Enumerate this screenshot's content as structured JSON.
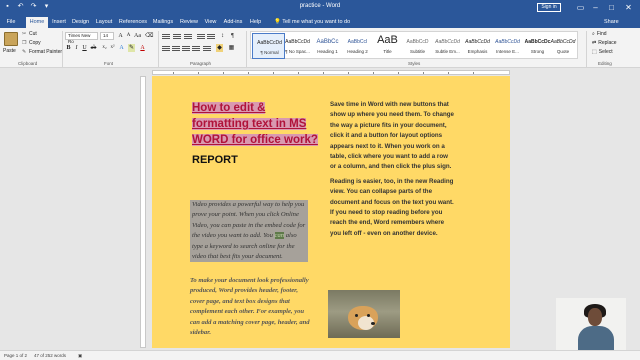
{
  "window": {
    "title": "practice - Word",
    "signin_label": "Sign in",
    "controls": [
      "–",
      "□",
      "✕"
    ]
  },
  "tabs": [
    "File",
    "Home",
    "Insert",
    "Design",
    "Layout",
    "References",
    "Mailings",
    "Review",
    "View",
    "Add-ins",
    "Help"
  ],
  "active_tab": "Home",
  "tell_me": "Tell me what you want to do",
  "share_label": "Share",
  "clipboard": {
    "paste_label": "Paste",
    "cut_label": "Cut",
    "copy_label": "Copy",
    "format_painter_label": "Format Painter",
    "group_label": "Clipboard"
  },
  "font": {
    "name": "Times New Ro",
    "size": "14",
    "group_label": "Font"
  },
  "paragraph": {
    "group_label": "Paragraph"
  },
  "styles": {
    "group_label": "Styles",
    "items": [
      {
        "sample": "AaBbCcDd",
        "name": "¶ Normal",
        "selected": true
      },
      {
        "sample": "AaBbCcDd",
        "name": "¶ No Spac...",
        "selected": false
      },
      {
        "sample": "AaBbCc",
        "name": "Heading 1",
        "selected": false
      },
      {
        "sample": "AaBbCcI",
        "name": "Heading 2",
        "selected": false
      },
      {
        "sample": "AaB",
        "name": "Title",
        "selected": false
      },
      {
        "sample": "AaBbCcD",
        "name": "Subtitle",
        "selected": false
      },
      {
        "sample": "AaBbCcDd",
        "name": "Subtle Em...",
        "selected": false
      },
      {
        "sample": "AaBbCcDd",
        "name": "Emphasis",
        "selected": false
      },
      {
        "sample": "AaBbCcDd",
        "name": "Intense E...",
        "selected": false
      },
      {
        "sample": "AaBbCcDc",
        "name": "Strong",
        "selected": false
      },
      {
        "sample": "AaBbCcDd",
        "name": "Quote",
        "selected": false
      }
    ]
  },
  "editing": {
    "find_label": "Find",
    "replace_label": "Replace",
    "select_label": "Select",
    "group_label": "Editing"
  },
  "document": {
    "heading": "How to edit & formatting text in MS WORD for office work?",
    "subheading": "REPORT",
    "para1_before": "Video provides a powerful way to help you prove your point. When you click Online Video, you can paste in the embed code for the video you want to add. You ",
    "para1_highlight": "can",
    "para1_after": " also type a keyword to search online for the video that best fits your document.",
    "para2": "To make your document look professionally produced, Word provides header, footer, cover page, and text box designs that complement each other. For example, you can add a matching cover page, header, and sidebar.",
    "right_para1": "Save time in Word with new buttons that show up where you need them. To change the way a picture fits in your document, click it and a button for layout options appears next to it. When you work on a table, click where you want to add a row or a column, and then click the plus sign.",
    "right_para2": "Reading is easier, too, in the new Reading view. You can collapse parts of the document and focus on the text you want. If you need to stop reading before you reach the end, Word remembers where you left off - even on another device."
  },
  "colors": {
    "title_bar": "#2b579a",
    "page": "#ffd966",
    "heading": "#b0133a",
    "highlight": "#a6a19a"
  },
  "status": {
    "page": "Page 1 of 2",
    "words": "47 of 252 words"
  }
}
